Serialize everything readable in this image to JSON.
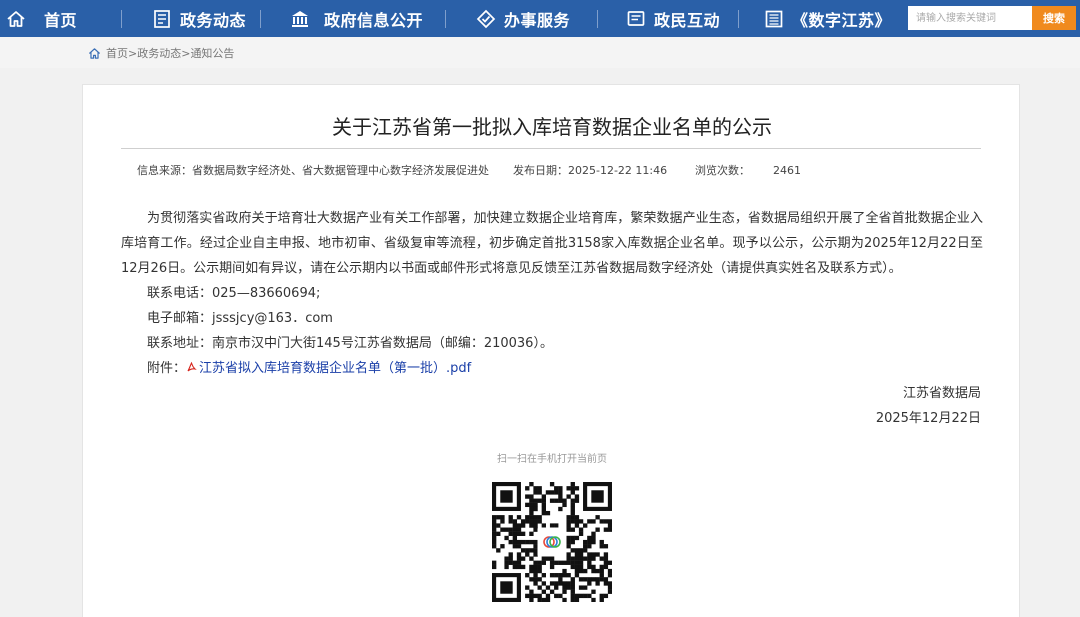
{
  "nav": {
    "items": [
      {
        "label": "首页",
        "icon": "home-icon"
      },
      {
        "label": "政务动态",
        "icon": "document-icon"
      },
      {
        "label": "政府信息公开",
        "icon": "government-building-icon"
      },
      {
        "label": "办事服务",
        "icon": "service-diamond-icon"
      },
      {
        "label": "政民互动",
        "icon": "chat-window-icon"
      },
      {
        "label": "《数字江苏》",
        "icon": "magazine-icon"
      }
    ],
    "search_placeholder": "请输入搜索关键词",
    "search_button": "搜索"
  },
  "breadcrumb": {
    "home": "首页",
    "sep1": ">",
    "section": "政务动态",
    "sep2": ">",
    "current": "通知公告"
  },
  "article": {
    "title": "关于江苏省第一批拟入库培育数据企业名单的公示",
    "meta": {
      "source_label": "信息来源：",
      "source": "省数据局数字经济处、省大数据管理中心数字经济发展促进处",
      "date_label": "发布日期：",
      "date": "2025-12-22 11:46",
      "views_label": "浏览次数：",
      "views": "2461"
    },
    "paragraph": "为贯彻落实省政府关于培育壮大数据产业有关工作部署，加快建立数据企业培育库，繁荣数据产业生态，省数据局组织开展了全省首批数据企业入库培育工作。经过企业自主申报、地市初审、省级复审等流程，初步确定首批3158家入库数据企业名单。现予以公示，公示期为2025年12月22日至12月26日。公示期间如有异议，请在公示期内以书面或邮件形式将意见反馈至江苏省数据局数字经济处（请提供真实姓名及联系方式）。",
    "phone": "联系电话：025—83660694;",
    "email": "电子邮箱：jsssjcy@163．com",
    "address": "联系地址：南京市汉中门大街145号江苏省数据局（邮编：210036）。",
    "attachment_label": "附件：",
    "attachment_link": "江苏省拟入库培育数据企业名单（第一批）.pdf",
    "signer": "江苏省数据局",
    "sign_date": "2025年12月22日"
  },
  "qr": {
    "caption": "扫一扫在手机打开当前页"
  },
  "colors": {
    "nav_bg": "#2a60a8",
    "search_button": "#f08a1e",
    "link": "#1a3fa8"
  }
}
